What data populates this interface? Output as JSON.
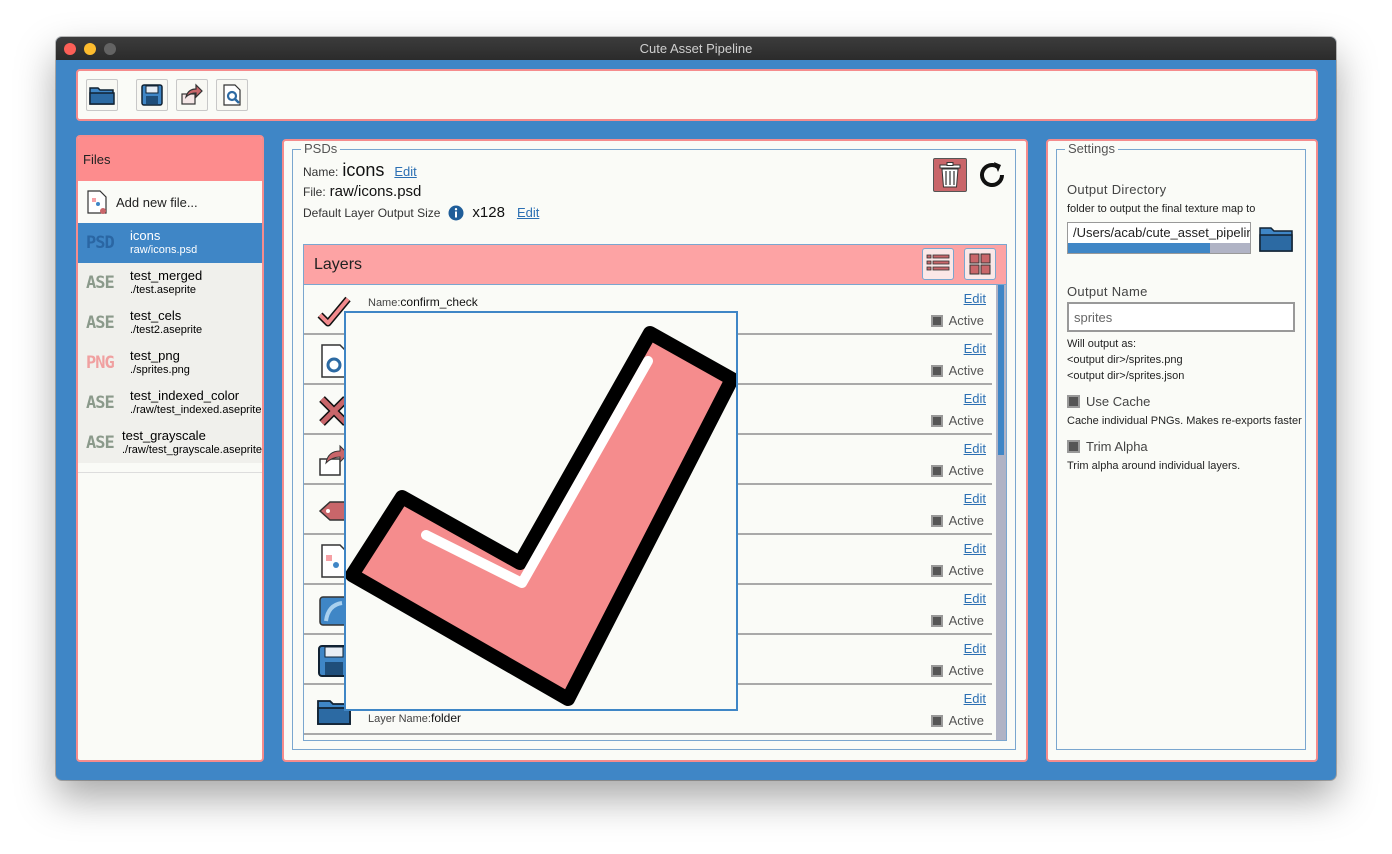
{
  "window": {
    "title": "Cute Asset Pipeline"
  },
  "toolbar": {
    "buttons": [
      {
        "icon": "folder-icon"
      },
      {
        "icon": "save-icon"
      },
      {
        "icon": "export-icon"
      },
      {
        "icon": "preview-icon"
      }
    ]
  },
  "files": {
    "header": "Files",
    "add_label": "Add new file...",
    "items": [
      {
        "badge": "PSD",
        "name": "icons",
        "path": "raw/icons.psd",
        "selected": true
      },
      {
        "badge": "ASE",
        "name": "test_merged",
        "path": "./test.aseprite"
      },
      {
        "badge": "ASE",
        "name": "test_cels",
        "path": "./test2.aseprite"
      },
      {
        "badge": "PNG",
        "name": "test_png",
        "path": "./sprites.png"
      },
      {
        "badge": "ASE",
        "name": "test_indexed_color",
        "path": "./raw/test_indexed.aseprite"
      },
      {
        "badge": "ASE",
        "name": "test_grayscale",
        "path": "./raw/test_grayscale.aseprite"
      }
    ]
  },
  "psds": {
    "legend": "PSDs",
    "name_label": "Name:",
    "name_value": "icons",
    "file_label": "File:",
    "file_value": "raw/icons.psd",
    "size_label": "Default Layer Output Size",
    "size_value": "x128",
    "edit": "Edit",
    "layers_title": "Layers",
    "layers": [
      {
        "label": "Name:",
        "name": "confirm_check",
        "active": "Active"
      },
      {
        "active": "Active"
      },
      {
        "active": "Active"
      },
      {
        "active": "Active"
      },
      {
        "active": "Active"
      },
      {
        "active": "Active"
      },
      {
        "active": "Active"
      },
      {
        "active": "Active"
      },
      {
        "label": "Layer Name:",
        "name": "folder",
        "active": "Active"
      }
    ]
  },
  "settings": {
    "legend": "Settings",
    "output_dir_title": "Output Directory",
    "output_dir_desc": "folder to output the final texture map to",
    "output_dir_value": "/Users/acab/cute_asset_pipelin",
    "output_dir_progress": 0.78,
    "output_name_title": "Output Name",
    "output_name_value": "sprites",
    "will_output": "Will output as:",
    "out_png": "<output dir>/sprites.png",
    "out_json": "<output dir>/sprites.json",
    "use_cache": "Use Cache",
    "use_cache_desc": "Cache individual PNGs. Makes re-exports faster",
    "trim_alpha": "Trim Alpha",
    "trim_alpha_desc": "Trim alpha around individual layers."
  },
  "colors": {
    "accent": "#3f86c6",
    "pink": "#fd8c8d",
    "panel": "#fafbf7"
  }
}
